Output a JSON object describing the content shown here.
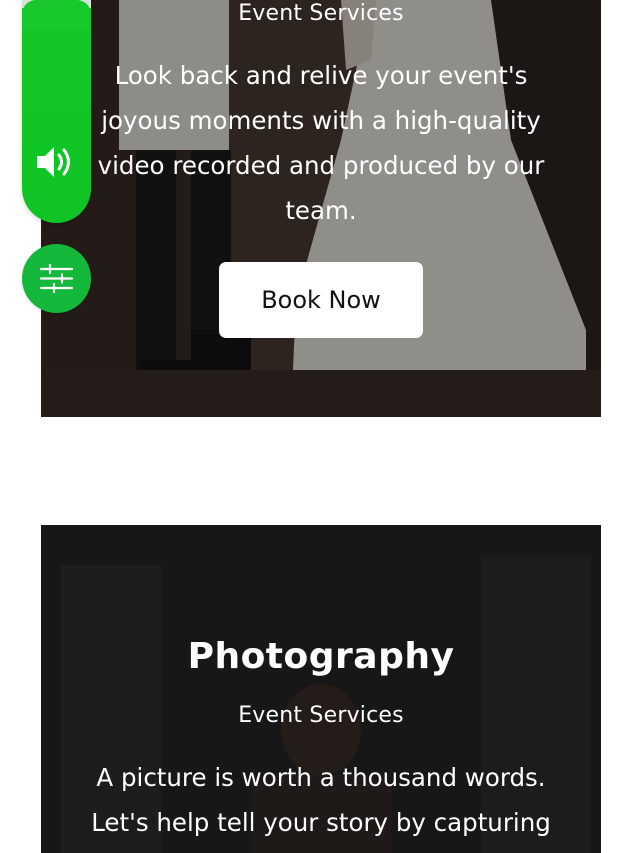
{
  "services": [
    {
      "subtitle": "Event Services",
      "description": "Look back and relive your event's joyous moments with a high-quality video recorded and produced by our team.",
      "button_label": "Book Now"
    },
    {
      "title": "Photography",
      "subtitle": "Event Services",
      "description": "A picture is worth a thousand words. Let's help tell your story by capturing"
    }
  ],
  "widgets": {
    "audio_icon": "speaker-volume-icon",
    "settings_icon": "sliders-icon",
    "accent_color": "#14c72a"
  }
}
